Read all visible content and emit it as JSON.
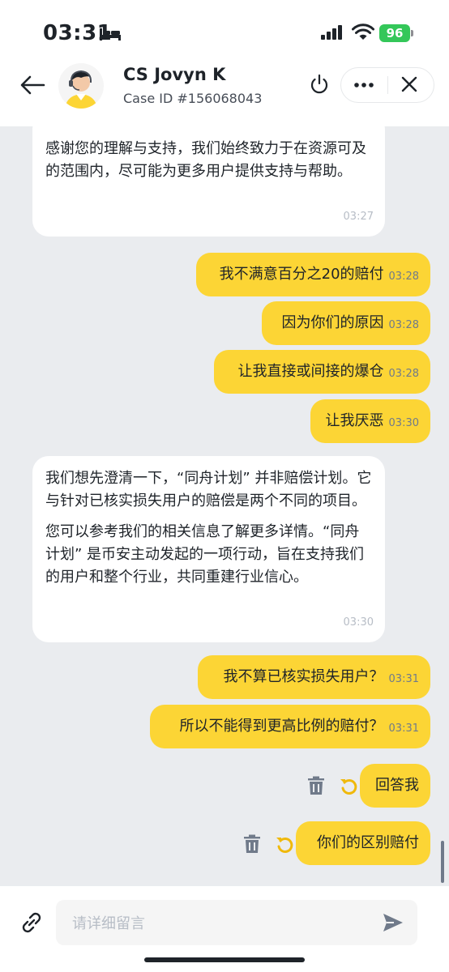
{
  "status_bar": {
    "time": "03:31",
    "battery": "96"
  },
  "header": {
    "agent_name": "CS Jovyn K",
    "case_id": "Case ID #156068043"
  },
  "messages": [
    {
      "side": "in",
      "paragraphs": [
        "感谢您的理解与支持，我们始终致力于在资源可及的范围内，尽可能为更多用户提供支持与帮助。"
      ],
      "time": "03:27"
    },
    {
      "side": "out",
      "text": "我不满意百分之20的赔付",
      "time": "03:28"
    },
    {
      "side": "out",
      "text": "因为你们的原因",
      "time": "03:28"
    },
    {
      "side": "out",
      "text": "让我直接或间接的爆仓",
      "time": "03:28"
    },
    {
      "side": "out",
      "text": "让我厌恶",
      "time": "03:30"
    },
    {
      "side": "in",
      "paragraphs": [
        "我们想先澄清一下，“同舟计划” 并非赔偿计划。它与针对已核实损失用户的赔偿是两个不同的项目。",
        "您可以参考我们的相关信息了解更多详情。“同舟计划” 是币安主动发起的一项行动，旨在支持我们的用户和整个行业，共同重建行业信心。"
      ],
      "time": "03:30"
    },
    {
      "side": "out",
      "text": "我不算已核实损失用户？",
      "time": "03:31"
    },
    {
      "side": "out",
      "text": "所以不能得到更高比例的赔付？",
      "time": "03:31"
    },
    {
      "side": "out",
      "text": "回答我",
      "time": "",
      "status": "failed"
    },
    {
      "side": "out",
      "text": "你们的区别赔付",
      "time": "",
      "status": "failed"
    }
  ],
  "composer": {
    "placeholder": "请详细留言"
  },
  "colors": {
    "accent": "#fcd535",
    "chat_bg": "#eaecef",
    "retry": "#f0b90b"
  },
  "icons": [
    "bed-icon",
    "signal-icon",
    "wifi-icon",
    "back-arrow-icon",
    "power-icon",
    "more-icon",
    "close-icon",
    "trash-icon",
    "retry-icon",
    "link-icon",
    "send-icon"
  ]
}
